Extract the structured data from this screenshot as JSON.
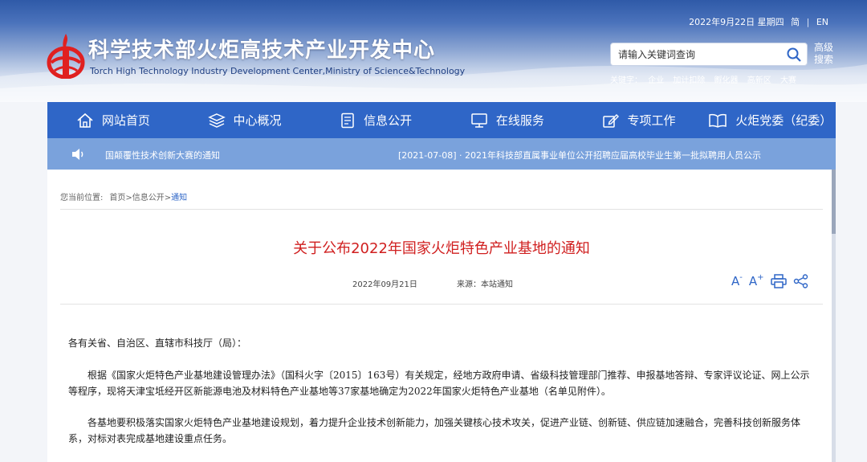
{
  "header": {
    "site_title": "科学技术部火炬高技术产业开发中心",
    "site_subtitle": "Torch High Technology Industry Development Center,Ministry of Science&Technology",
    "date": "2022年9月22日 星期四",
    "lang_simplified": "简",
    "lang_separator": "|",
    "lang_english": "EN",
    "search_placeholder": "请输入关键词查询",
    "advanced_search": "高级搜索",
    "keywords_label": "关键字：",
    "keywords": [
      "企业",
      "加计扣除",
      "孵化器",
      "高新区",
      "大赛"
    ]
  },
  "nav": {
    "items": [
      {
        "label": "网站首页",
        "icon": "home-icon"
      },
      {
        "label": "中心概况",
        "icon": "layers-icon"
      },
      {
        "label": "信息公开",
        "icon": "document-icon"
      },
      {
        "label": "在线服务",
        "icon": "monitor-icon"
      },
      {
        "label": "专项工作",
        "icon": "edit-icon"
      },
      {
        "label": "火炬党委（纪委）",
        "icon": "book-icon"
      }
    ]
  },
  "notice": {
    "item1": "国颠覆性技术创新大赛的通知",
    "item2": "[2021-07-08] · 2021年科技部直属事业单位公开招聘应届高校毕业生第一批拟聘用人员公示"
  },
  "breadcrumb": {
    "label": "您当前位置:",
    "home": "首页",
    "sep": ">",
    "section": "信息公开",
    "current": "通知"
  },
  "article": {
    "title": "关于公布2022年国家火炬特色产业基地的通知",
    "date": "2022年09月21日",
    "source": "来源：本站通知",
    "paragraphs": [
      "各有关省、自治区、直辖市科技厅（局）：",
      "根据《国家火炬特色产业基地建设管理办法》（国科火字〔2015〕163号）有关规定，经地方政府申请、省级科技管理部门推荐、申报基地答辩、专家评议论证、网上公示等程序，现将天津宝坻经开区新能源电池及材料特色产业基地等37家基地确定为2022年国家火炬特色产业基地（名单见附件）。",
      "各基地要积极落实国家火炬特色产业基地建设规划，着力提升企业技术创新能力，加强关键核心技术攻关，促进产业链、创新链、供应链加速融合，完善科技创新服务体系，对标对表完成基地建设重点任务。"
    ]
  },
  "tools": {
    "font_larger": "A",
    "font_smaller": "A",
    "font_plus": "+",
    "font_minus": "-"
  },
  "colors": {
    "nav_bg": "#2f66c7",
    "notice_bg": "#7aa2dc",
    "title_red": "#d01f1f",
    "accent": "#2f66c7"
  }
}
